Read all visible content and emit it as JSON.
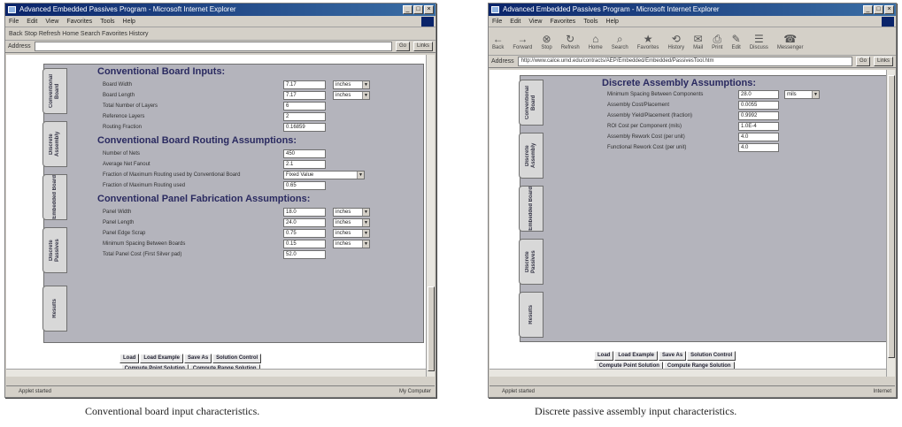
{
  "left": {
    "title": "Advanced Embedded Passives Program - Microsoft Internet Explorer",
    "menu": [
      "File",
      "Edit",
      "View",
      "Favorites",
      "Tools",
      "Help"
    ],
    "toolbar_text": "Back  Stop  Refresh  Home  Search  Favorites  History",
    "address_label": "Address",
    "address": "",
    "go": "Go",
    "links": "Links",
    "tabs": [
      "Conventional Board",
      "Discrete Assembly",
      "Embedded Board",
      "Discrete Passives",
      "Results"
    ],
    "sec1": "Conventional Board Inputs:",
    "sec1_rows": [
      {
        "label": "Board Width",
        "value": "7.17",
        "unit": "inches"
      },
      {
        "label": "Board Length",
        "value": "7.17",
        "unit": "inches"
      },
      {
        "label": "Total Number of Layers",
        "value": "6",
        "unit": ""
      },
      {
        "label": "Reference Layers",
        "value": "2",
        "unit": ""
      },
      {
        "label": "Routing Fraction",
        "value": "0.16859",
        "unit": ""
      }
    ],
    "sec2": "Conventional Board Routing Assumptions:",
    "sec2_rows": [
      {
        "label": "Number of Nets",
        "value": "450"
      },
      {
        "label": "Average Net Fanout",
        "value": "2.1"
      },
      {
        "label": "Fraction of Maximum Routing used by Conventional Board",
        "value": "Fixed Value",
        "select": true
      },
      {
        "label": "Fraction of Maximum Routing used",
        "value": "0.65"
      }
    ],
    "sec3": "Conventional Panel Fabrication Assumptions:",
    "sec3_rows": [
      {
        "label": "Panel Width",
        "value": "18.0",
        "unit": "inches"
      },
      {
        "label": "Panel Length",
        "value": "24.0",
        "unit": "inches"
      },
      {
        "label": "Panel Edge Scrap",
        "value": "0.75",
        "unit": "inches"
      },
      {
        "label": "Minimum Spacing Between Boards",
        "value": "0.15",
        "unit": "inches"
      },
      {
        "label": "Total Panel Cost (First Silver pad)",
        "value": "52.0",
        "unit": ""
      }
    ],
    "buttons_row1": [
      "Load",
      "Load Example",
      "Save As",
      "Solution Control"
    ],
    "buttons_row2": [
      "Compute Point Solution",
      "Compute Range Solution"
    ],
    "status": "Applet started",
    "zone": "My Computer",
    "caption": "Conventional board input characteristics."
  },
  "right": {
    "title": "Advanced Embedded Passives Program - Microsoft Internet Explorer",
    "menu": [
      "File",
      "Edit",
      "View",
      "Favorites",
      "Tools",
      "Help"
    ],
    "toolbar_buttons": [
      {
        "glyph": "←",
        "label": "Back"
      },
      {
        "glyph": "→",
        "label": "Forward"
      },
      {
        "glyph": "⊗",
        "label": "Stop"
      },
      {
        "glyph": "↻",
        "label": "Refresh"
      },
      {
        "glyph": "⌂",
        "label": "Home"
      },
      {
        "glyph": "⌕",
        "label": "Search"
      },
      {
        "glyph": "★",
        "label": "Favorites"
      },
      {
        "glyph": "⟲",
        "label": "History"
      },
      {
        "glyph": "✉",
        "label": "Mail"
      },
      {
        "glyph": "⎙",
        "label": "Print"
      },
      {
        "glyph": "✎",
        "label": "Edit"
      },
      {
        "glyph": "☰",
        "label": "Discuss"
      },
      {
        "glyph": "☎",
        "label": "Messenger"
      }
    ],
    "address_label": "Address",
    "address": "http://www.calce.umd.edu/contracts/AEP/Embedded/Embedded/PassivesTool.htm",
    "go": "Go",
    "links": "Links",
    "tabs": [
      "Conventional Board",
      "Discrete Assembly",
      "Embedded Board",
      "Discrete Passives",
      "Results"
    ],
    "sec": "Discrete Assembly Assumptions:",
    "rows": [
      {
        "label": "Minimum Spacing Between Components",
        "value": "28.0",
        "unit": "mils"
      },
      {
        "label": "Assembly Cost/Placement",
        "value": "0.0055",
        "unit": ""
      },
      {
        "label": "Assembly Yield/Placement (fraction)",
        "value": "0.9992",
        "unit": ""
      },
      {
        "label": "ROI Cost per Component (mils)",
        "value": "1.0E-4",
        "unit": ""
      },
      {
        "label": "Assembly Rework Cost (per unit)",
        "value": "4.0",
        "unit": ""
      },
      {
        "label": "Functional Rework Cost (per unit)",
        "value": "4.0",
        "unit": ""
      }
    ],
    "buttons_row1": [
      "Load",
      "Load Example",
      "Save As",
      "Solution Control"
    ],
    "buttons_row2": [
      "Compute Point Solution",
      "Compute Range Solution"
    ],
    "status": "Applet started",
    "zone": "Internet",
    "caption": "Discrete passive assembly input characteristics."
  }
}
